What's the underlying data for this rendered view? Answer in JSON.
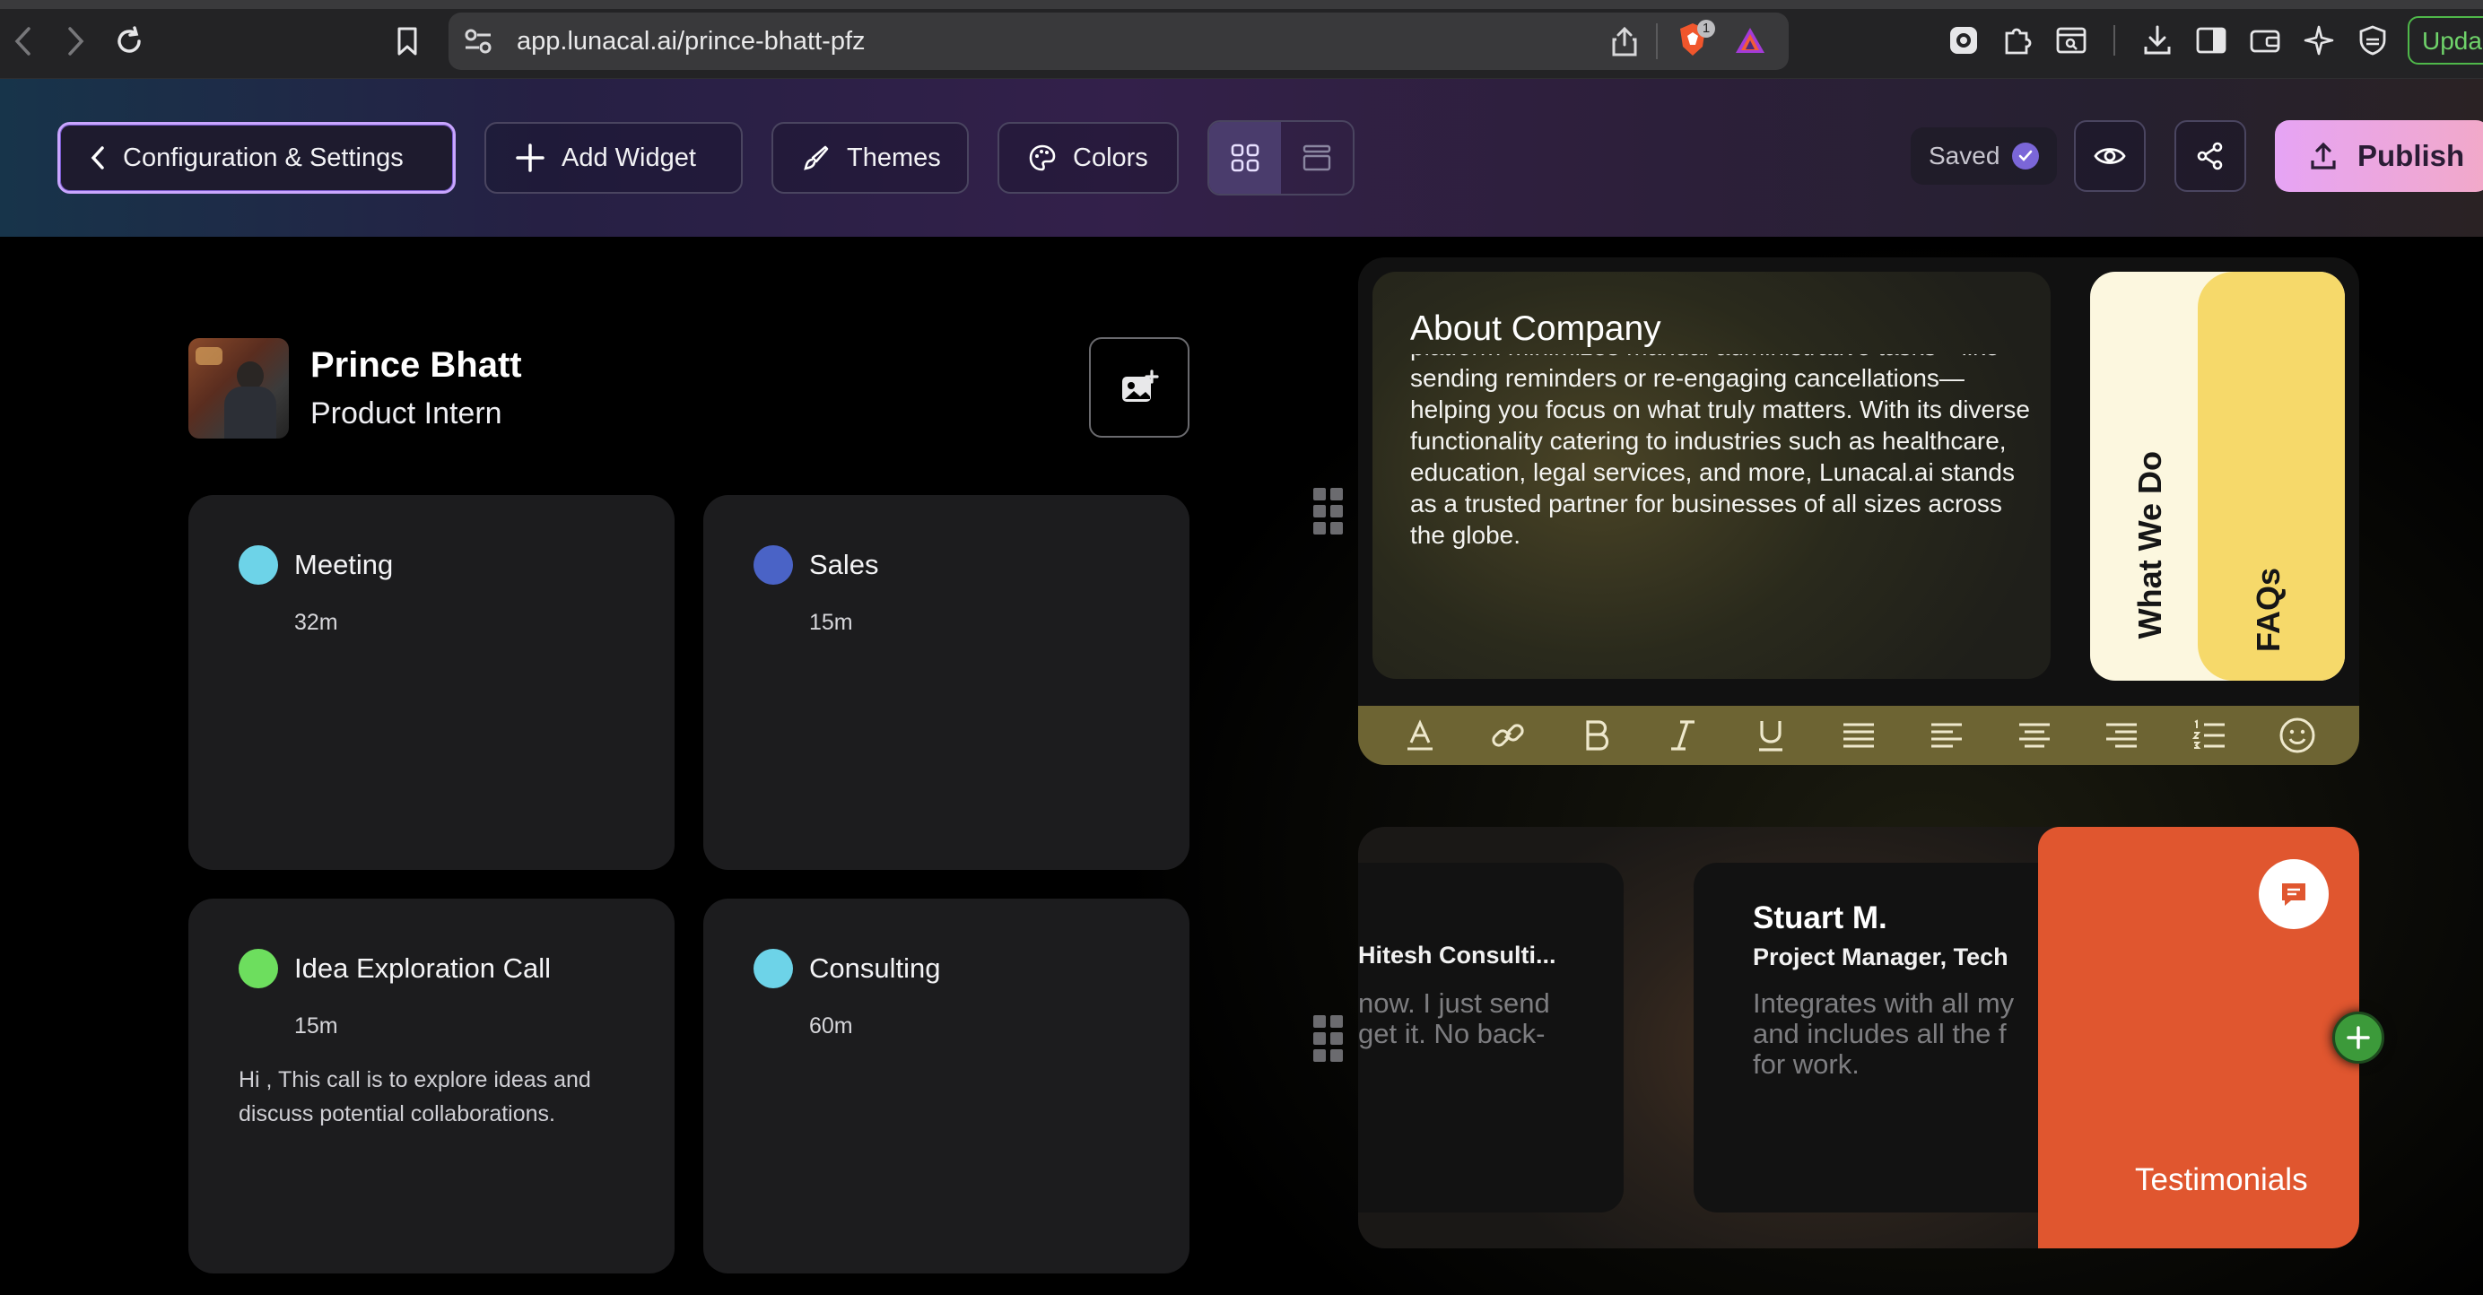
{
  "browser": {
    "url": "app.lunacal.ai/prince-bhatt-pfz",
    "update_label": "Upda",
    "shield_badge": "1"
  },
  "toolbar": {
    "config_label": "Configuration & Settings",
    "add_widget_label": "Add Widget",
    "themes_label": "Themes",
    "colors_label": "Colors",
    "saved_label": "Saved",
    "publish_label": "Publish"
  },
  "profile": {
    "name": "Prince Bhatt",
    "role": "Product Intern"
  },
  "events": [
    {
      "title": "Meeting",
      "duration": "32m",
      "color": "#6dd3e8",
      "description": ""
    },
    {
      "title": "Sales",
      "duration": "15m",
      "color": "#4a63c6",
      "description": ""
    },
    {
      "title": "Idea Exploration Call",
      "duration": "15m",
      "color": "#6dde5e",
      "description": "Hi , This call is to explore ideas and discuss potential collaborations."
    },
    {
      "title": "Consulting",
      "duration": "60m",
      "color": "#6dd3e8",
      "description": ""
    }
  ],
  "about": {
    "heading": "About Company",
    "body": "platform minimizes manual administrative tasks—like sending reminders or re-engaging cancellations—helping you focus on what truly matters. With its diverse functionality catering to industries such as healthcare, education, legal services, and more, Lunacal.ai stands as a trusted partner for businesses of all sizes across the globe.",
    "tab_what_we_do": "What We Do",
    "tab_faqs": "FAQs",
    "accent": "#f6d96a"
  },
  "testimonials": {
    "panel_label": "Testimonials",
    "accent": "#e0562f",
    "items": [
      {
        "name": "",
        "role": "Hitesh Consulti...",
        "quote_line1": "now. I just send",
        "quote_line2": "get it. No back-"
      },
      {
        "name": "Stuart M.",
        "role": "Project Manager, Tech",
        "quote_line1": "Integrates with all my",
        "quote_line2": "and includes all the f",
        "quote_line3": "for work."
      }
    ]
  }
}
